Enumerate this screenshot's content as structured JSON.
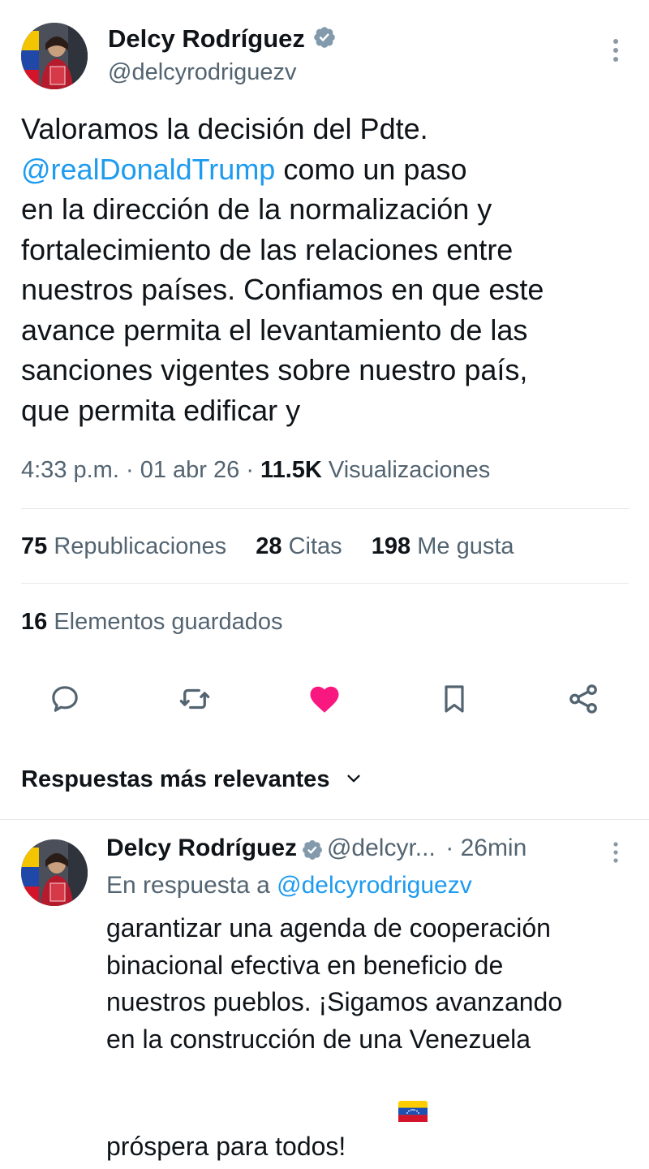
{
  "tweet": {
    "author_name": "Delcy Rodríguez",
    "author_handle": "@delcyrodriguezv",
    "text_lines": [
      "Valoramos la decisión del Pdte.",
      "@realDonaldTrump",
      " como un paso",
      "en la dirección de la normalización y",
      "fortalecimiento de las relaciones entre",
      "nuestros países. Confiamos en que este",
      "avance permita el levantamiento de las",
      "sanciones vigentes sobre nuestro país,",
      "que permita edificar y"
    ],
    "time": "4:33 p.m.",
    "sep": "·",
    "date": "01 abr 26",
    "views_count": "11.5K",
    "views_label": "Visualizaciones"
  },
  "stats": {
    "reposts_count": "75",
    "reposts_label": "Republicaciones",
    "quotes_count": "28",
    "quotes_label": "Citas",
    "likes_count": "198",
    "likes_label": "Me gusta",
    "bookmarks_count": "16",
    "bookmarks_label": "Elementos guardados"
  },
  "actions": [
    "reply-icon",
    "repost-icon",
    "like-icon",
    "bookmark-icon",
    "share-icon"
  ],
  "colors": {
    "accent": "#1d9bf0",
    "like": "#f91880",
    "muted": "#536471",
    "verified": "#829aab"
  },
  "replies": {
    "section_title": "Respuestas más relevantes",
    "items": [
      {
        "author_name": "Delcy Rodríguez",
        "author_handle": "@delcyr...",
        "time": "· 26min",
        "in_reply_prefix": "En respuesta a ",
        "in_reply_handle": "@delcyrodriguezv",
        "text_lines": [
          "garantizar una agenda de cooperación",
          "binacional efectiva en beneficio de",
          "nuestros pueblos. ¡Sigamos avanzando",
          "en la construcción de una Venezuela",
          "próspera para todos! "
        ],
        "flag_emoji": "🇻🇪"
      }
    ]
  }
}
